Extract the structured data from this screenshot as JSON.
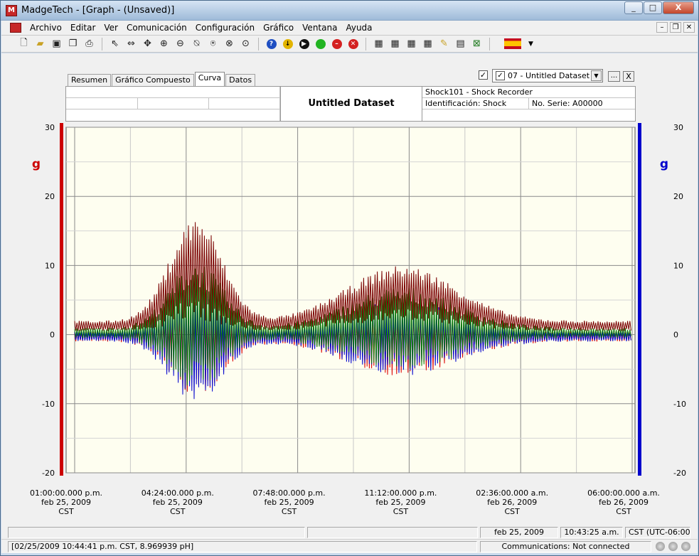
{
  "window": {
    "title": "MadgeTech - [Graph - (Unsaved)]",
    "controls": {
      "minimize": "_",
      "maximize": "□",
      "close": "X"
    }
  },
  "menu": {
    "items": [
      {
        "label": "Archivo",
        "mnemonic": "A"
      },
      {
        "label": "Editar",
        "mnemonic": "E"
      },
      {
        "label": "Ver",
        "mnemonic": "V"
      },
      {
        "label": "Comunicación",
        "mnemonic": "C"
      },
      {
        "label": "Configuración",
        "mnemonic": "C"
      },
      {
        "label": "Gráfico",
        "mnemonic": "G"
      },
      {
        "label": "Ventana",
        "mnemonic": "V"
      },
      {
        "label": "Ayuda",
        "mnemonic": "A"
      }
    ],
    "mdi_controls": {
      "minimize": "–",
      "restore": "❐",
      "close": "✕"
    }
  },
  "toolbar": {
    "icons": [
      "new-document-icon",
      "open-folder-icon",
      "save-icon",
      "save-all-icon",
      "print-icon",
      "pointer-icon",
      "pan-horizontal-icon",
      "pan-move-icon",
      "zoom-in-icon",
      "zoom-out-icon",
      "zoom-horizontal-icon",
      "zoom-vertical-icon",
      "zoom-fit-icon",
      "zoom-reset-icon",
      "help-icon",
      "download-icon",
      "play-icon",
      "start-icon",
      "stop-icon",
      "cancel-icon",
      "stats-1-icon",
      "stats-2-icon",
      "stats-3-icon",
      "stats-4-icon",
      "annotate-icon",
      "calculator-icon",
      "excel-icon"
    ],
    "language_flag": "spain-flag-icon"
  },
  "tabs": [
    {
      "label": "Resumen",
      "active": false
    },
    {
      "label": "Gráfico Compuesto",
      "active": false
    },
    {
      "label": "Curva",
      "active": true
    },
    {
      "label": "Datos",
      "active": false
    }
  ],
  "dataset_selector": {
    "value": "07 - Untitled Dataset",
    "more_label": "...",
    "close_label": "X"
  },
  "header": {
    "dataset_title": "Untitled Dataset",
    "device": "Shock101 - Shock Recorder",
    "identification": "Identificación: Shock",
    "serial": "No. Serie: A00000"
  },
  "chart_data": {
    "type": "line",
    "title": "",
    "ylabel_left": "g",
    "ylabel_right": "g",
    "ylim": [
      -20,
      30
    ],
    "yticks": [
      30,
      20,
      10,
      0,
      -10,
      -20
    ],
    "grid": true,
    "background": "#fefef0",
    "xticks": [
      {
        "time": "01:00:00.000 p.m.",
        "date": "feb 25, 2009",
        "tz": "CST"
      },
      {
        "time": "04:24:00.000 p.m.",
        "date": "feb 25, 2009",
        "tz": "CST"
      },
      {
        "time": "07:48:00.000 p.m.",
        "date": "feb 25, 2009",
        "tz": "CST"
      },
      {
        "time": "11:12:00.000 p.m.",
        "date": "feb 25, 2009",
        "tz": "CST"
      },
      {
        "time": "02:36:00.000 a.m.",
        "date": "feb 26, 2009",
        "tz": "CST"
      },
      {
        "time": "06:00:00.000 a.m.",
        "date": "feb 26, 2009",
        "tz": "CST"
      }
    ],
    "series": [
      {
        "color": "#7a0000",
        "envelope": {
          "events": [
            {
              "center_x": "04:24:00.000 p.m.",
              "peak": 17,
              "trough": 2
            },
            {
              "center_x": "11:12:00.000 p.m.",
              "peak": 10,
              "trough": 2
            }
          ],
          "baseline": [
            0.5,
            2
          ]
        }
      },
      {
        "color": "#0a7a0a",
        "envelope": {
          "events": [
            {
              "center_x": "04:24:00.000 p.m.",
              "peak": 11,
              "trough": -8
            },
            {
              "center_x": "11:12:00.000 p.m.",
              "peak": 7,
              "trough": -5
            }
          ],
          "baseline": [
            -0.5,
            1
          ]
        }
      },
      {
        "color": "#0000cc",
        "envelope": {
          "events": [
            {
              "center_x": "04:24:00.000 p.m.",
              "peak": 8,
              "trough": -10
            },
            {
              "center_x": "11:12:00.000 p.m.",
              "peak": 5,
              "trough": -6
            }
          ],
          "baseline": [
            -1,
            0.5
          ]
        }
      },
      {
        "color": "#dd0000",
        "envelope": {
          "events": [
            {
              "center_x": "04:24:00.000 p.m.",
              "peak": 6,
              "trough": -9
            },
            {
              "center_x": "11:12:00.000 p.m.",
              "peak": 4,
              "trough": -6
            }
          ],
          "baseline": [
            -1,
            0.5
          ]
        }
      }
    ],
    "left_axis_color": "#cc0000",
    "right_axis_color": "#0000cc"
  },
  "status": {
    "row1": {
      "date": "feb 25, 2009",
      "time": "10:43:25 a.m.",
      "timezone": "CST (UTC-06:00)"
    },
    "row2": {
      "cursor_readout": "[02/25/2009 10:44:41 p.m. CST, 8.969939 pH]",
      "communications": "Communications: Not connected"
    }
  }
}
